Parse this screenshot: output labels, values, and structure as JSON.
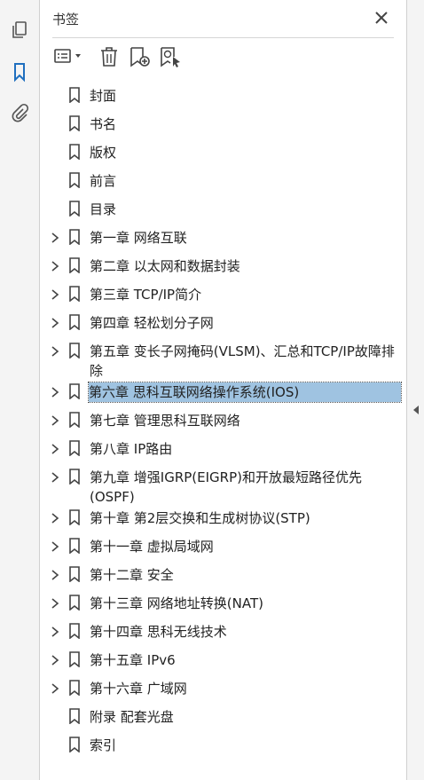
{
  "panel": {
    "title": "书签"
  },
  "bookmarks": [
    {
      "label": "封面",
      "expandable": false
    },
    {
      "label": "书名",
      "expandable": false
    },
    {
      "label": "版权",
      "expandable": false
    },
    {
      "label": "前言",
      "expandable": false
    },
    {
      "label": "目录",
      "expandable": false
    },
    {
      "label": "第一章 网络互联",
      "expandable": true
    },
    {
      "label": "第二章 以太网和数据封装",
      "expandable": true
    },
    {
      "label": "第三章 TCP/IP简介",
      "expandable": true
    },
    {
      "label": "第四章 轻松划分子网",
      "expandable": true
    },
    {
      "label": "第五章 变长子网掩码(VLSM)、汇总和TCP/IP故障排除",
      "expandable": true
    },
    {
      "label": "第六章 思科互联网络操作系统(IOS)",
      "expandable": true,
      "selected": true
    },
    {
      "label": "第七章 管理思科互联网络",
      "expandable": true
    },
    {
      "label": "第八章 IP路由",
      "expandable": true
    },
    {
      "label": "第九章 增强IGRP(EIGRP)和开放最短路径优先(OSPF)",
      "expandable": true
    },
    {
      "label": "第十章 第2层交换和生成树协议(STP)",
      "expandable": true
    },
    {
      "label": "第十一章 虚拟局域网",
      "expandable": true
    },
    {
      "label": "第十二章 安全",
      "expandable": true
    },
    {
      "label": "第十三章 网络地址转换(NAT)",
      "expandable": true
    },
    {
      "label": "第十四章 思科无线技术",
      "expandable": true
    },
    {
      "label": "第十五章 IPv6",
      "expandable": true
    },
    {
      "label": "第十六章 广域网",
      "expandable": true
    },
    {
      "label": "附录 配套光盘",
      "expandable": false
    },
    {
      "label": "索引",
      "expandable": false
    }
  ],
  "icons": {
    "rail": [
      "pages-icon",
      "bookmark-icon",
      "attachment-icon"
    ],
    "toolbar": [
      "options-menu-icon",
      "delete-icon",
      "new-bookmark-icon",
      "new-bookmark-from-structure-icon"
    ]
  },
  "colors": {
    "accent": "#1f6fbf",
    "selection": "#9fc3e1"
  }
}
